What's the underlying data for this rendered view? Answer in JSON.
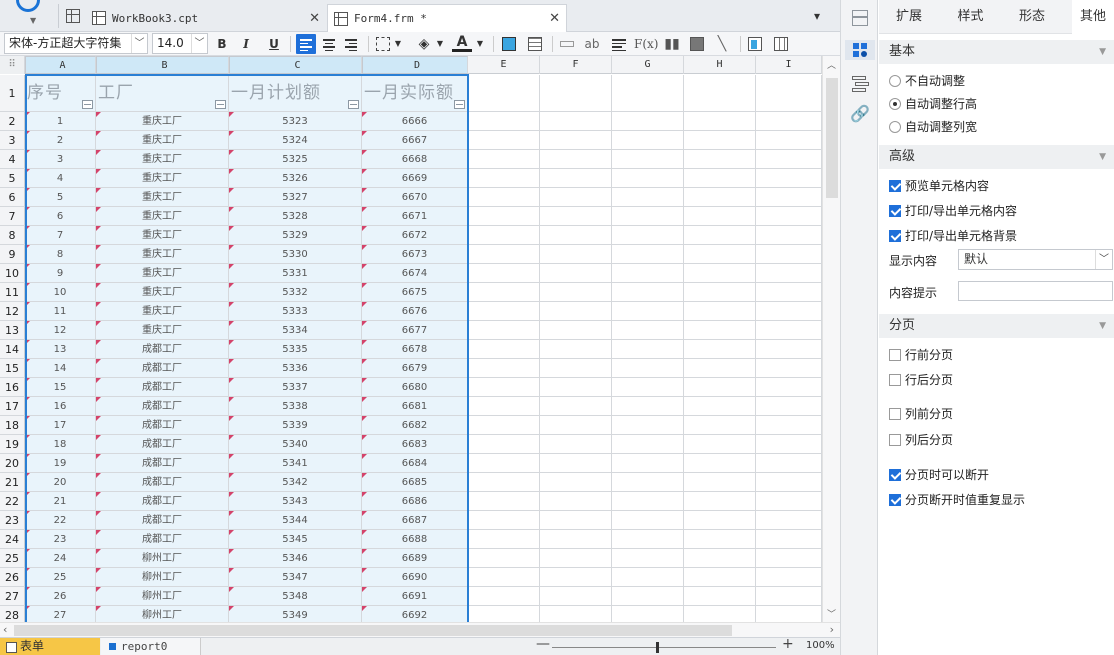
{
  "tabs": {
    "workbook": "WorkBook3.cpt",
    "form": "Form4.frm *"
  },
  "toolbar": {
    "font_family": "宋体-方正超大字符集",
    "font_size": "14.0",
    "bold": "B",
    "italic": "I",
    "underline": "U"
  },
  "sheet": {
    "columns": [
      "A",
      "B",
      "C",
      "D",
      "E",
      "F",
      "G",
      "H",
      "I"
    ],
    "header_row": [
      "序号",
      "工厂",
      "一月计划额",
      "一月实际额"
    ],
    "rows": [
      [
        "1",
        "重庆工厂",
        "5323",
        "6666"
      ],
      [
        "2",
        "重庆工厂",
        "5324",
        "6667"
      ],
      [
        "3",
        "重庆工厂",
        "5325",
        "6668"
      ],
      [
        "4",
        "重庆工厂",
        "5326",
        "6669"
      ],
      [
        "5",
        "重庆工厂",
        "5327",
        "6670"
      ],
      [
        "6",
        "重庆工厂",
        "5328",
        "6671"
      ],
      [
        "7",
        "重庆工厂",
        "5329",
        "6672"
      ],
      [
        "8",
        "重庆工厂",
        "5330",
        "6673"
      ],
      [
        "9",
        "重庆工厂",
        "5331",
        "6674"
      ],
      [
        "10",
        "重庆工厂",
        "5332",
        "6675"
      ],
      [
        "11",
        "重庆工厂",
        "5333",
        "6676"
      ],
      [
        "12",
        "重庆工厂",
        "5334",
        "6677"
      ],
      [
        "13",
        "成都工厂",
        "5335",
        "6678"
      ],
      [
        "14",
        "成都工厂",
        "5336",
        "6679"
      ],
      [
        "15",
        "成都工厂",
        "5337",
        "6680"
      ],
      [
        "16",
        "成都工厂",
        "5338",
        "6681"
      ],
      [
        "17",
        "成都工厂",
        "5339",
        "6682"
      ],
      [
        "18",
        "成都工厂",
        "5340",
        "6683"
      ],
      [
        "19",
        "成都工厂",
        "5341",
        "6684"
      ],
      [
        "20",
        "成都工厂",
        "5342",
        "6685"
      ],
      [
        "21",
        "成都工厂",
        "5343",
        "6686"
      ],
      [
        "22",
        "成都工厂",
        "5344",
        "6687"
      ],
      [
        "23",
        "成都工厂",
        "5345",
        "6688"
      ],
      [
        "24",
        "柳州工厂",
        "5346",
        "6689"
      ],
      [
        "25",
        "柳州工厂",
        "5347",
        "6690"
      ],
      [
        "26",
        "柳州工厂",
        "5348",
        "6691"
      ],
      [
        "27",
        "柳州工厂",
        "5349",
        "6692"
      ]
    ]
  },
  "bottom": {
    "sheet_tab_form": "表单",
    "sheet_tab_report": "report0",
    "zoom": "100%"
  },
  "panel": {
    "tabs": [
      "扩展",
      "样式",
      "形态",
      "其他"
    ],
    "active_tab": 3,
    "basic": {
      "title": "基本",
      "options": [
        {
          "label": "不自动调整",
          "checked": false
        },
        {
          "label": "自动调整行高",
          "checked": true
        },
        {
          "label": "自动调整列宽",
          "checked": false
        }
      ]
    },
    "advanced": {
      "title": "高级",
      "checks": [
        {
          "label": "预览单元格内容",
          "checked": true
        },
        {
          "label": "打印/导出单元格内容",
          "checked": true
        },
        {
          "label": "打印/导出单元格背景",
          "checked": true
        }
      ],
      "display_label": "显示内容",
      "display_value": "默认",
      "hint_label": "内容提示",
      "hint_value": ""
    },
    "paging": {
      "title": "分页",
      "checks": [
        {
          "label": "行前分页",
          "checked": false
        },
        {
          "label": "行后分页",
          "checked": false
        },
        {
          "label": "列前分页",
          "checked": false
        },
        {
          "label": "列后分页",
          "checked": false
        },
        {
          "label": "分页时可以断开",
          "checked": true
        },
        {
          "label": "分页断开时值重复显示",
          "checked": true
        }
      ]
    }
  }
}
